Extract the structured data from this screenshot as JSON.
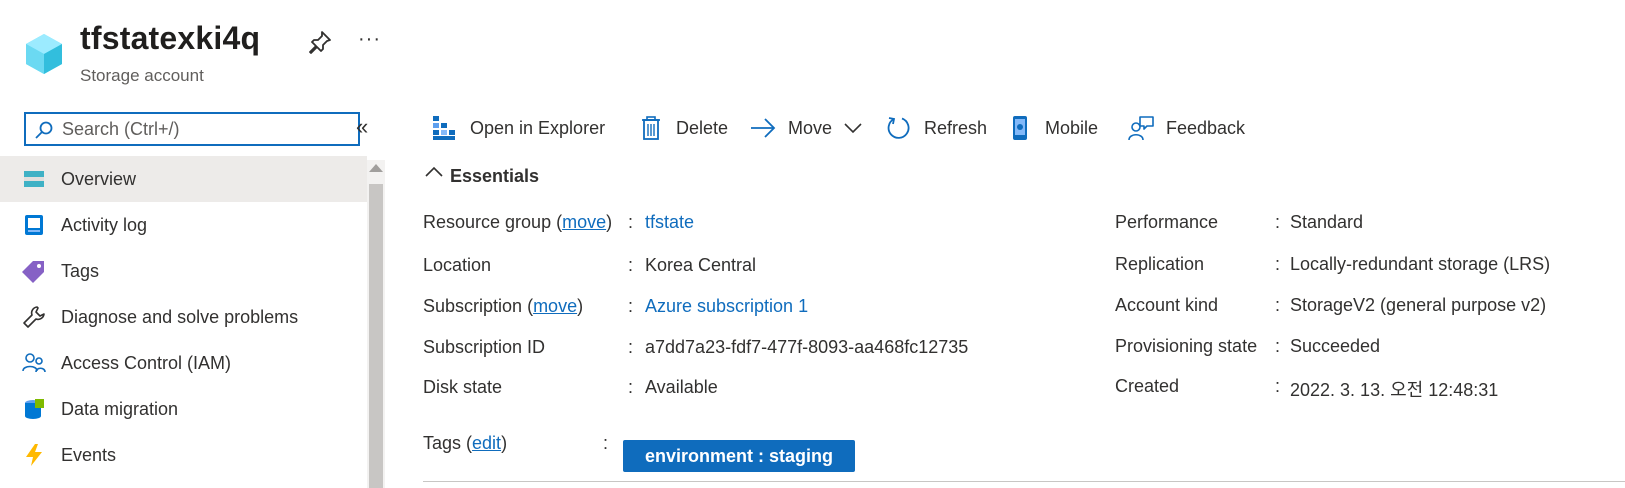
{
  "header": {
    "title": "tfstatexki4q",
    "subtitle": "Storage account",
    "more_label": "···"
  },
  "search": {
    "placeholder": "Search (Ctrl+/)",
    "collapse_label": "«"
  },
  "sidebar": {
    "items": [
      {
        "label": "Overview",
        "icon": "overview-icon",
        "active": true
      },
      {
        "label": "Activity log",
        "icon": "activity-log-icon"
      },
      {
        "label": "Tags",
        "icon": "tag-icon"
      },
      {
        "label": "Diagnose and solve problems",
        "icon": "wrench-icon"
      },
      {
        "label": "Access Control (IAM)",
        "icon": "people-icon"
      },
      {
        "label": "Data migration",
        "icon": "data-migration-icon"
      },
      {
        "label": "Events",
        "icon": "lightning-icon"
      }
    ]
  },
  "toolbar": {
    "open_explorer": "Open in Explorer",
    "delete": "Delete",
    "move": "Move",
    "refresh": "Refresh",
    "mobile": "Mobile",
    "feedback": "Feedback"
  },
  "essentials": {
    "title": "Essentials",
    "left": {
      "resource_group": {
        "key": "Resource group",
        "link": "move",
        "value": "tfstate"
      },
      "location": {
        "key": "Location",
        "value": "Korea Central"
      },
      "subscription": {
        "key": "Subscription",
        "link": "move",
        "value": "Azure subscription 1"
      },
      "subscription_id": {
        "key": "Subscription ID",
        "value": "a7dd7a23-fdf7-477f-8093-aa468fc12735"
      },
      "disk_state": {
        "key": "Disk state",
        "value": "Available"
      }
    },
    "right": {
      "performance": {
        "key": "Performance",
        "value": "Standard"
      },
      "replication": {
        "key": "Replication",
        "value": "Locally-redundant storage (LRS)"
      },
      "account_kind": {
        "key": "Account kind",
        "value": "StorageV2 (general purpose v2)"
      },
      "provisioning_state": {
        "key": "Provisioning state",
        "value": "Succeeded"
      },
      "created": {
        "key": "Created",
        "value": "2022. 3. 13. 오전 12:48:31"
      }
    },
    "tags": {
      "key": "Tags",
      "link": "edit",
      "value": "environment : staging"
    }
  },
  "colors": {
    "accent": "#0f6cbd",
    "active_nav_bg": "#edebe9"
  }
}
